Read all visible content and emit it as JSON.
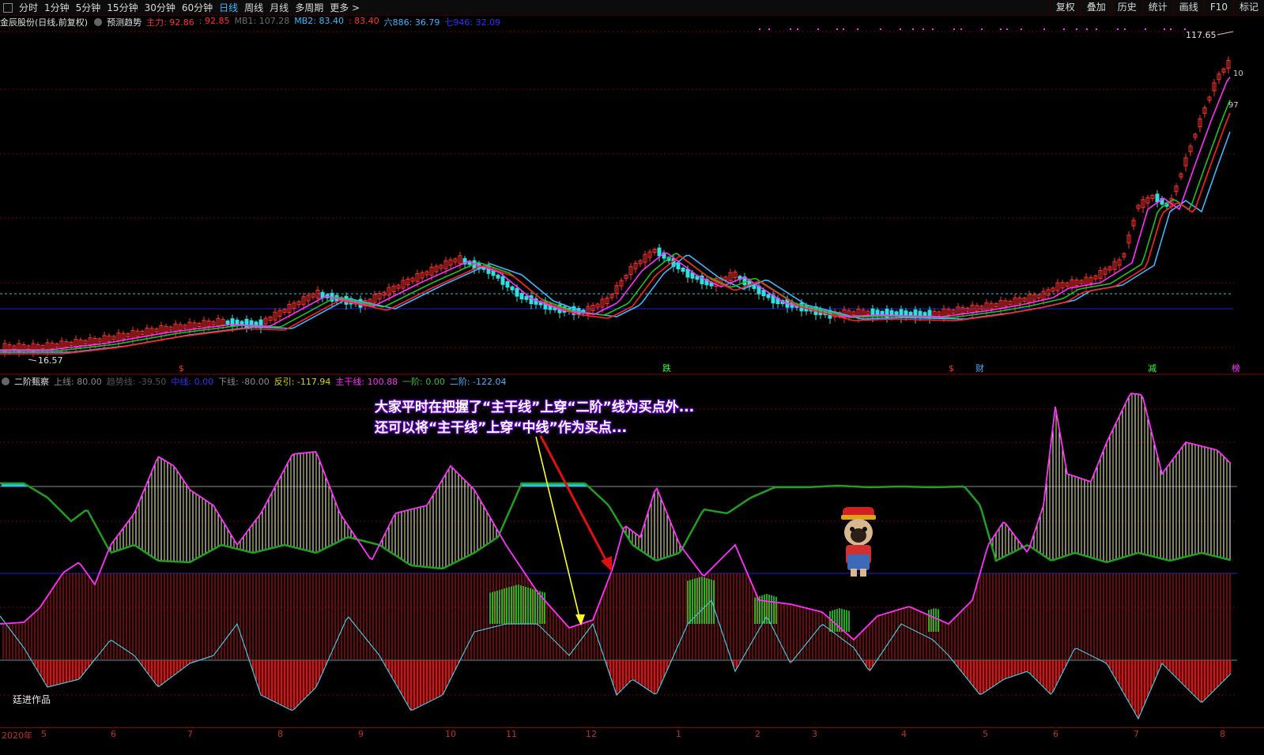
{
  "toolbar": {
    "periods": [
      "分时",
      "1分钟",
      "5分钟",
      "15分钟",
      "30分钟",
      "60分钟",
      "日线",
      "周线",
      "月线",
      "多周期",
      "更多 >"
    ],
    "active_period": "日线",
    "right_buttons": [
      "复权",
      "叠加",
      "历史",
      "统计",
      "画线",
      "F10",
      "标记"
    ]
  },
  "main_panel": {
    "stock_name": "金辰股份(日线,前复权)",
    "predict_label": "预测趋势",
    "indicators": [
      {
        "label": "主力: 92.86",
        "color": "#ff3030"
      },
      {
        "label": ": 92.85",
        "color": "#ff3030"
      },
      {
        "label": "MB1: 107.28",
        "color": "#6a6a6a"
      },
      {
        "label": "MB2: 83.40",
        "color": "#3fb6ff"
      },
      {
        "label": ": 83.40",
        "color": "#ff3030"
      },
      {
        "label": "六886: 36.79",
        "color": "#3fb6ff"
      },
      {
        "label": "七946: 32.09",
        "color": "#3030ff"
      }
    ],
    "high_label": "117.65",
    "low_label": "16.57",
    "price_tags": [
      "10",
      "97"
    ],
    "event_markers": [
      {
        "text": "$",
        "color": "#ff3030"
      },
      {
        "text": "跌",
        "color": "#30ff30"
      },
      {
        "text": "$",
        "color": "#ff3030"
      },
      {
        "text": "财",
        "color": "#3fb6ff"
      },
      {
        "text": "减",
        "color": "#30ff30"
      },
      {
        "text": "榜",
        "color": "#ff30ff"
      }
    ]
  },
  "sub_panel": {
    "title": "二阶甄察",
    "indicators": [
      {
        "label": "上线: 80.00",
        "color": "#8a8a8a"
      },
      {
        "label": "趋势线: -39.50",
        "color": "#555555"
      },
      {
        "label": "中线: 0.00",
        "color": "#3030ff"
      },
      {
        "label": "下线: -80.00",
        "color": "#8a8a8a"
      },
      {
        "label": "反引: -117.94",
        "color": "#d8d800"
      },
      {
        "label": "主干线: 100.88",
        "color": "#ff30ff"
      },
      {
        "label": "一阶: 0.00",
        "color": "#30c030"
      },
      {
        "label": "二阶: -122.04",
        "color": "#3fb6ff"
      }
    ],
    "callout_line1": "大家平时在把握了“主干线”上穿“二阶”线为买点外...",
    "callout_line2": "还可以将“主干线”上穿“中线”作为买点...",
    "author": "廷进作品"
  },
  "x_axis": {
    "labels": [
      "2020年",
      "5",
      "6",
      "7",
      "8",
      "9",
      "10",
      "11",
      "12",
      "1",
      "2",
      "3",
      "4",
      "5",
      "6",
      "7",
      "8"
    ]
  },
  "colors": {
    "background": "#000000",
    "up_candle": "#ff3030",
    "down_candle": "#30e0e0",
    "ma_red": "#ff2020",
    "ma_magenta": "#ff30ff",
    "ma_green": "#20c020",
    "ma_cyan": "#3fb6ff",
    "grid": "#7a0000"
  }
}
